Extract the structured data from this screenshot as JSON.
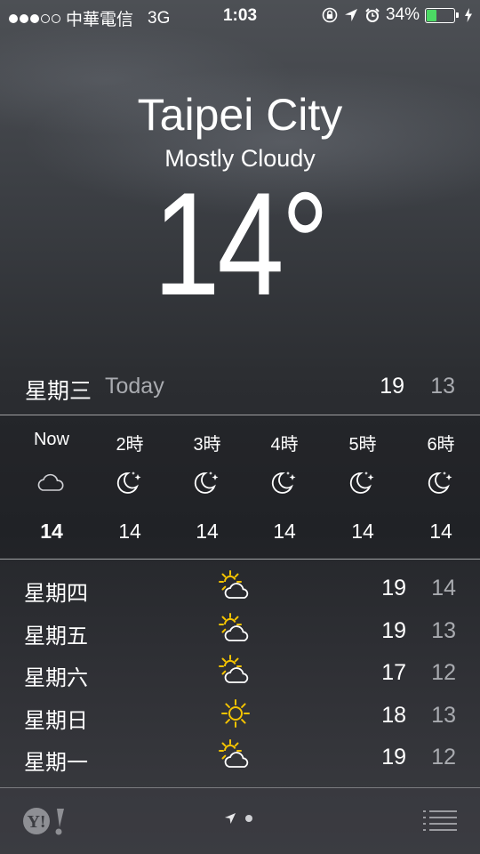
{
  "status_bar": {
    "signal_dots": [
      true,
      true,
      true,
      false,
      false
    ],
    "carrier": "中華電信",
    "network": "3G",
    "time": "1:03",
    "battery_percent_text": "34%",
    "battery_level": 0.34,
    "battery_color": "#4cd964",
    "icons": [
      "rotation-lock-icon",
      "location-arrow-icon",
      "alarm-icon",
      "charging-bolt-icon"
    ]
  },
  "weather": {
    "city": "Taipei City",
    "condition": "Mostly Cloudy",
    "temperature": "14°"
  },
  "today": {
    "day": "星期三",
    "label": "Today",
    "high": "19",
    "low": "13"
  },
  "hourly": [
    {
      "label": "Now",
      "icon": "cloud-icon",
      "temp": "14",
      "bold": true
    },
    {
      "label": "2時",
      "icon": "moon-stars-icon",
      "temp": "14",
      "bold": false
    },
    {
      "label": "3時",
      "icon": "moon-stars-icon",
      "temp": "14",
      "bold": false
    },
    {
      "label": "4時",
      "icon": "moon-stars-icon",
      "temp": "14",
      "bold": false
    },
    {
      "label": "5時",
      "icon": "moon-stars-icon",
      "temp": "14",
      "bold": false
    },
    {
      "label": "6時",
      "icon": "moon-stars-icon",
      "temp": "14",
      "bold": false
    }
  ],
  "daily": [
    {
      "day": "星期四",
      "icon": "partly-sunny-icon",
      "high": "19",
      "low": "14"
    },
    {
      "day": "星期五",
      "icon": "partly-sunny-icon",
      "high": "19",
      "low": "13"
    },
    {
      "day": "星期六",
      "icon": "partly-sunny-icon",
      "high": "17",
      "low": "12"
    },
    {
      "day": "星期日",
      "icon": "sun-icon",
      "high": "18",
      "low": "13"
    },
    {
      "day": "星期一",
      "icon": "partly-sunny-icon",
      "high": "19",
      "low": "12"
    }
  ],
  "footer": {
    "logo": "Y!",
    "icons": [
      "yahoo-logo-icon",
      "location-page-icon",
      "list-menu-icon"
    ]
  },
  "colors": {
    "sun": "#f5c400",
    "dim_text": "#a9abb0"
  }
}
